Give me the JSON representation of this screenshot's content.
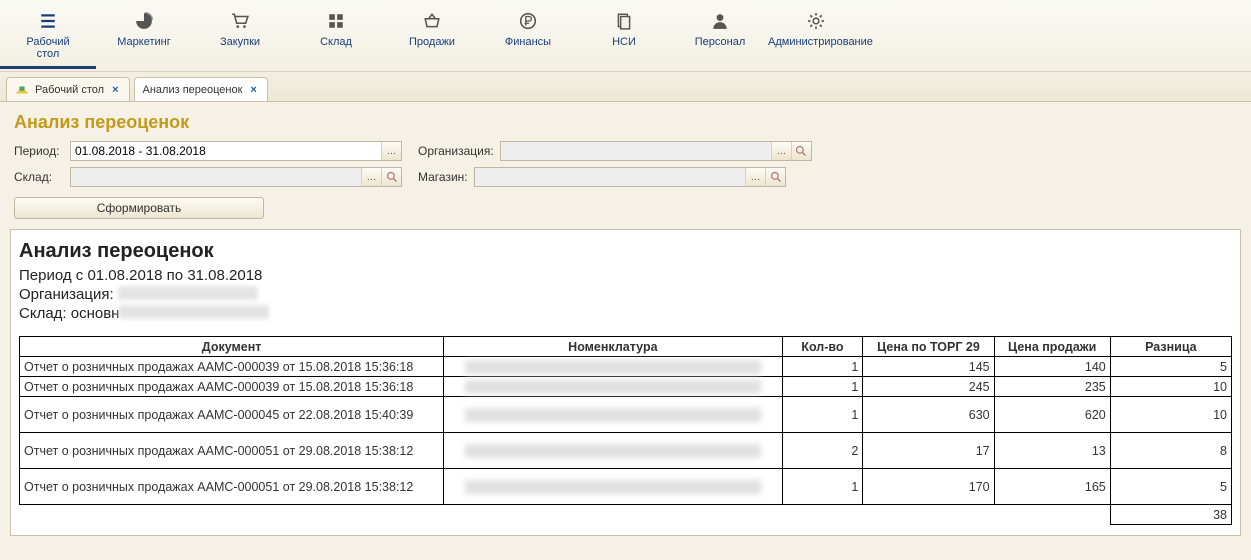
{
  "nav": {
    "items": [
      {
        "label": "Рабочий\nстол",
        "icon": "menu"
      },
      {
        "label": "Маркетинг",
        "icon": "pie"
      },
      {
        "label": "Закупки",
        "icon": "cart"
      },
      {
        "label": "Склад",
        "icon": "grid"
      },
      {
        "label": "Продажи",
        "icon": "basket"
      },
      {
        "label": "Финансы",
        "icon": "ruble"
      },
      {
        "label": "НСИ",
        "icon": "docs"
      },
      {
        "label": "Персонал",
        "icon": "person"
      },
      {
        "label": "Администрирование",
        "icon": "gear"
      }
    ],
    "active_index": 0
  },
  "tabs": {
    "items": [
      {
        "label": "Рабочий стол",
        "has_icon": true
      },
      {
        "label": "Анализ переоценок",
        "has_icon": false
      }
    ],
    "active_index": 1
  },
  "page": {
    "title": "Анализ переоценок"
  },
  "filters": {
    "period_label": "Период:",
    "period_value": "01.08.2018 - 31.08.2018",
    "org_label": "Организация:",
    "org_value": "",
    "warehouse_label": "Склад:",
    "warehouse_value": "",
    "store_label": "Магазин:",
    "store_value": "",
    "generate_label": "Сформировать"
  },
  "report": {
    "title": "Анализ переоценок",
    "period_line": "Период с 01.08.2018 по 31.08.2018",
    "org_line_prefix": "Организация:",
    "warehouse_line_prefix": "Склад: основн",
    "columns": {
      "document": "Документ",
      "nomenclature": "Номенклатура",
      "quantity": "Кол-во",
      "price_torg29": "Цена по ТОРГ 29",
      "sale_price": "Цена продажи",
      "difference": "Разница"
    },
    "rows": [
      {
        "document": "Отчет о розничных продажах ААМС-000039 от 15.08.2018 15:36:18",
        "qty": 1,
        "torg29": 145,
        "sale": 140,
        "diff": 5
      },
      {
        "document": "Отчет о розничных продажах ААМС-000039 от 15.08.2018 15:36:18",
        "qty": 1,
        "torg29": 245,
        "sale": 235,
        "diff": 10
      },
      {
        "document": "Отчет о розничных продажах ААМС-000045 от 22.08.2018 15:40:39",
        "qty": 1,
        "torg29": 630,
        "sale": 620,
        "diff": 10,
        "tall": true
      },
      {
        "document": "Отчет о розничных продажах ААМС-000051 от 29.08.2018 15:38:12",
        "qty": 2,
        "torg29": 17,
        "sale": 13,
        "diff": 8,
        "tall": true
      },
      {
        "document": "Отчет о розничных продажах ААМС-000051 от 29.08.2018 15:38:12",
        "qty": 1,
        "torg29": 170,
        "sale": 165,
        "diff": 5,
        "tall": true
      }
    ],
    "total_diff": 38
  }
}
